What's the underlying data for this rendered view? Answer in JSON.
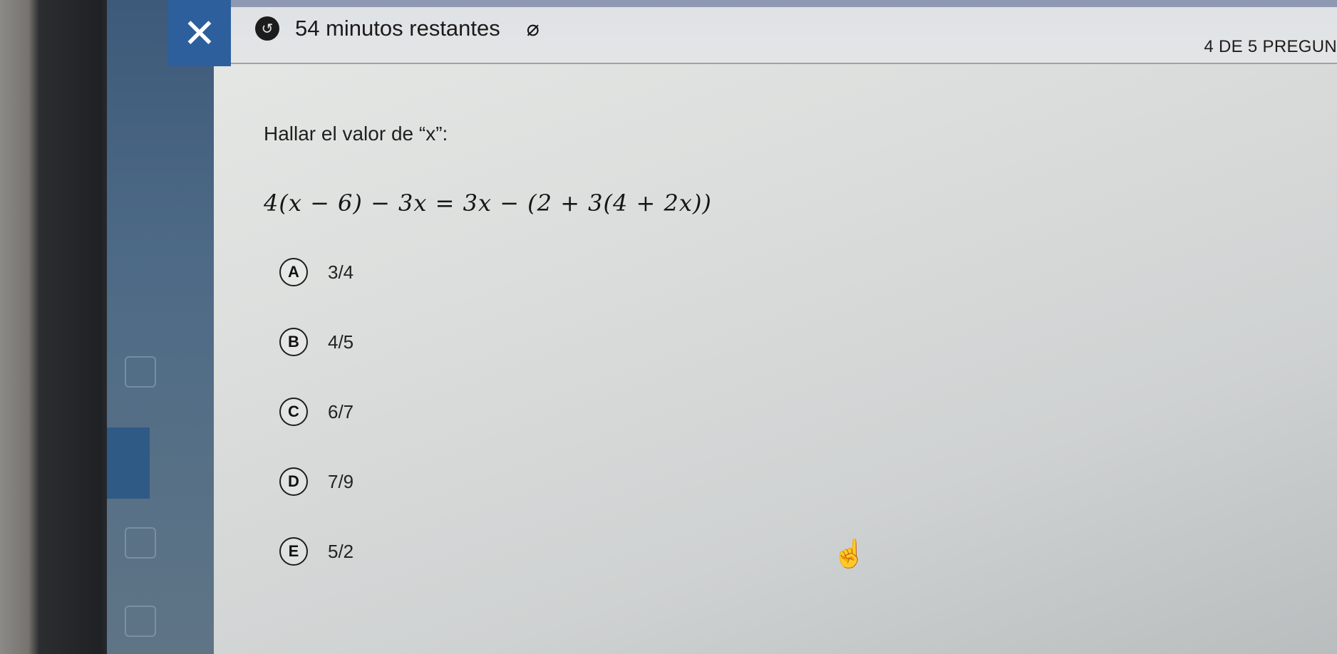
{
  "window": {
    "close_label": "✕"
  },
  "header": {
    "timer_icon": "timer-icon",
    "timer_text": "54 minutos restantes",
    "hide_icon": "eye-slash-icon",
    "progress_text": "4 DE 5 PREGUN"
  },
  "question": {
    "prompt": "Hallar el valor de “x”:",
    "equation": "4(x − 6) − 3x = 3x − (2 + 3(4 + 2x))"
  },
  "options": [
    {
      "letter": "A",
      "value": "3/4"
    },
    {
      "letter": "B",
      "value": "4/5"
    },
    {
      "letter": "C",
      "value": "6/7"
    },
    {
      "letter": "D",
      "value": "7/9"
    },
    {
      "letter": "E",
      "value": "5/2"
    }
  ],
  "cursor": {
    "icon": "hand-pointer-icon"
  }
}
